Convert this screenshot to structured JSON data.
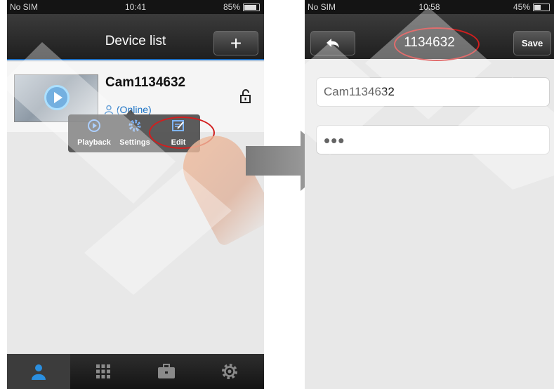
{
  "left_screen": {
    "status_bar": {
      "carrier": "No SIM",
      "time": "10:41",
      "battery": "85%",
      "battery_level": 0.85
    },
    "nav": {
      "title": "Device list",
      "add_icon": "plus-icon"
    },
    "device": {
      "name": "Cam1134632",
      "status": "(Online)",
      "thumbnail_icon": "play-icon",
      "person_icon": "person-icon",
      "lock_icon": "unlock-icon"
    },
    "popup_menu": {
      "items": [
        {
          "label": "Playback",
          "icon": "playback-icon"
        },
        {
          "label": "Settings",
          "icon": "gear-icon"
        },
        {
          "label": "Edit",
          "icon": "edit-icon"
        }
      ]
    },
    "tab_bar": {
      "tabs": [
        {
          "icon": "person-icon",
          "active": true
        },
        {
          "icon": "grid-icon",
          "active": false
        },
        {
          "icon": "briefcase-icon",
          "active": false
        },
        {
          "icon": "gear-icon",
          "active": false
        }
      ]
    }
  },
  "right_screen": {
    "status_bar": {
      "carrier": "No SIM",
      "time": "10:58",
      "battery": "45%",
      "battery_level": 0.45
    },
    "nav": {
      "title": "1134632",
      "back_icon": "back-arrow-icon",
      "save_label": "Save"
    },
    "name_field": {
      "value": "Cam1134632"
    },
    "password_field": {
      "value": "•••"
    }
  },
  "colors": {
    "accent": "#1d6fc4",
    "highlight": "#d21e1e",
    "nav": "#2a2a2a"
  }
}
